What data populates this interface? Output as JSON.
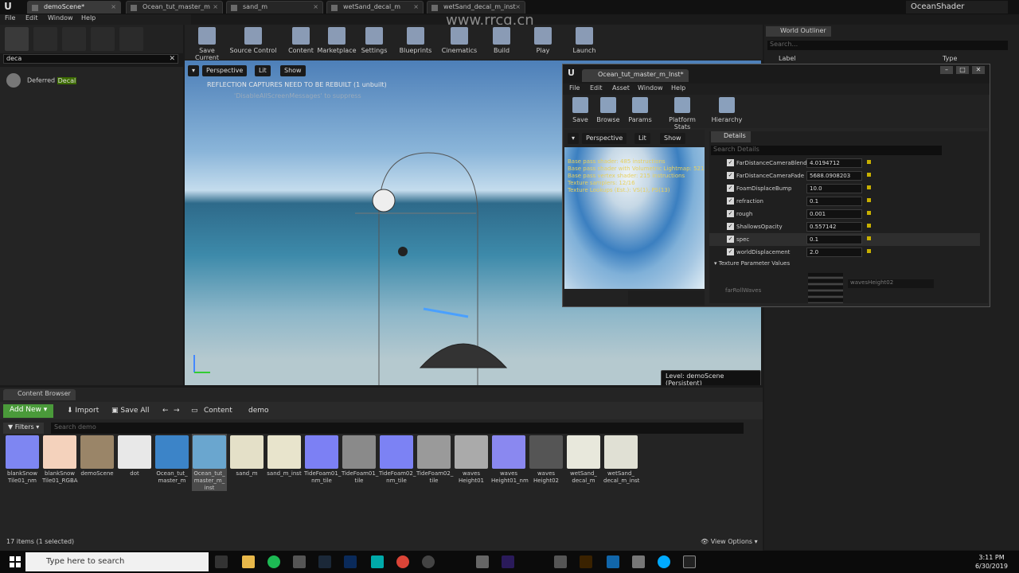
{
  "tabs": [
    {
      "label": "demoScene*"
    },
    {
      "label": "Ocean_tut_master_m"
    },
    {
      "label": "sand_m"
    },
    {
      "label": "wetSand_decal_m"
    },
    {
      "label": "wetSand_decal_m_inst"
    }
  ],
  "app_title": "OceanShader",
  "menu": [
    "File",
    "Edit",
    "Window",
    "Help"
  ],
  "modes_search": {
    "value": "deca"
  },
  "search_result": {
    "prefix": "Deferred ",
    "highlight": "Decal"
  },
  "toolbar": [
    "Save Current",
    "Source Control",
    "Content",
    "Marketplace",
    "Settings",
    "Blueprints",
    "Cinematics",
    "Build",
    "Play",
    "Launch"
  ],
  "viewport": {
    "perspective": "Perspective",
    "lit": "Lit",
    "show": "Show",
    "warning": "REFLECTION CAPTURES NEED TO BE REBUILT (1 unbuilt)",
    "warning2": "'DisableAllScreenMessages' to suppress",
    "level": "Level:  demoScene (Persistent)"
  },
  "watermark": "www.rrcg.cn",
  "content_browser": {
    "tab": "Content Browser",
    "add_new": "Add New",
    "import": "Import",
    "save_all": "Save All",
    "path": [
      "Content",
      "demo"
    ],
    "filters": "Filters",
    "search_placeholder": "Search demo",
    "assets": [
      {
        "name": "blankSnow Tile01_nm",
        "color": "#7e86f2"
      },
      {
        "name": "blankSnow Tile01_RGBA",
        "color": "#f4d2bc"
      },
      {
        "name": "demoScene",
        "color": "#9a8568"
      },
      {
        "name": "dot",
        "color": "#e8e8e8"
      },
      {
        "name": "Ocean_tut_ master_m",
        "color": "#3c84c8"
      },
      {
        "name": "Ocean_tut_ master_m_ inst",
        "color": "#6aa6cf"
      },
      {
        "name": "sand_m",
        "color": "#e4e0c8"
      },
      {
        "name": "sand_m_inst",
        "color": "#e8e4cc"
      },
      {
        "name": "TideFoam01_ nm_tile",
        "color": "#7c80f4"
      },
      {
        "name": "TideFoam01_ tile",
        "color": "#8a8a8a"
      },
      {
        "name": "TideFoam02_ nm_tile",
        "color": "#7c82f4"
      },
      {
        "name": "TideFoam02_ tile",
        "color": "#9a9a9a"
      },
      {
        "name": "waves Height01",
        "color": "#aaaaaa"
      },
      {
        "name": "waves Height01_nm",
        "color": "#8a88f0"
      },
      {
        "name": "waves Height02",
        "color": "#555555"
      },
      {
        "name": "wetSand_ decal_m",
        "color": "#e8e8dc"
      },
      {
        "name": "wetSand_ decal_m_inst",
        "color": "#e0e0d4"
      }
    ],
    "items": "17 items (1 selected)",
    "view_options": "View Options"
  },
  "outliner": {
    "tab": "World Outliner",
    "search": "Search...",
    "col_label": "Label",
    "col_type": "Type"
  },
  "material": {
    "tab": "Ocean_tut_master_m_Inst*",
    "menu": [
      "File",
      "Edit",
      "Asset",
      "Window",
      "Help"
    ],
    "toolbar": [
      "Save",
      "Browse",
      "Params",
      "Platform Stats",
      "Hierarchy"
    ],
    "preview": {
      "perspective": "Perspective",
      "lit": "Lit",
      "show": "Show",
      "stats": [
        "Base pass shader: 485 instructions",
        "Base pass shader with Volumetric Lightmap: 521 in",
        "Base pass vertex shader: 215 instructions",
        "Texture samplers: 12/16",
        "Texture Lookups (Est.): VS(1), PS(13)"
      ]
    },
    "details": {
      "tab": "Details",
      "search": "Search Details",
      "rows": [
        {
          "label": "FarDistanceCameraBlend",
          "value": "4.0194712"
        },
        {
          "label": "FarDistanceCameraFade",
          "value": "5688.0908203"
        },
        {
          "label": "FoamDisplaceBump",
          "value": "10.0"
        },
        {
          "label": "refraction",
          "value": "0.1"
        },
        {
          "label": "rough",
          "value": "0.001"
        },
        {
          "label": "ShallowsOpacity",
          "value": "0.557142"
        },
        {
          "label": "spec",
          "value": "0.1"
        },
        {
          "label": "worldDisplacement",
          "value": "2.0"
        }
      ],
      "tex_header": "Texture Parameter Values",
      "tex_row": "farRollWaves",
      "tex_select": "wavesHeight02"
    }
  },
  "taskbar": {
    "search": "Type here to search",
    "time": "3:11 PM",
    "date": "6/30/2019"
  }
}
